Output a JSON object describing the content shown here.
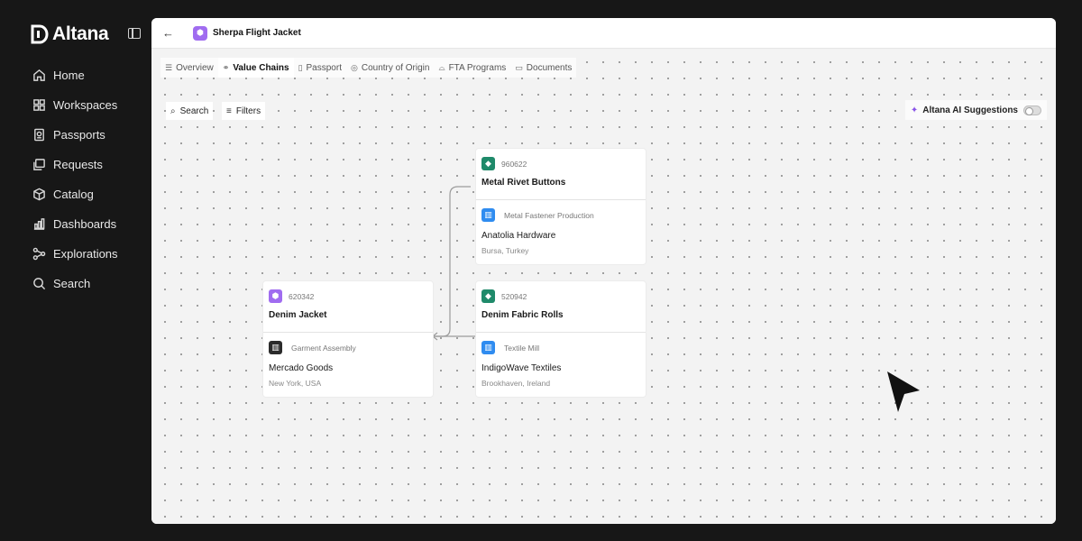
{
  "app": {
    "brand": "Altana"
  },
  "sidebar": {
    "items": [
      {
        "label": "Home",
        "icon": "home-icon"
      },
      {
        "label": "Workspaces",
        "icon": "grid-icon"
      },
      {
        "label": "Passports",
        "icon": "passport-icon"
      },
      {
        "label": "Requests",
        "icon": "requests-icon"
      },
      {
        "label": "Catalog",
        "icon": "box-icon"
      },
      {
        "label": "Dashboards",
        "icon": "bar-chart-icon"
      },
      {
        "label": "Explorations",
        "icon": "network-icon"
      },
      {
        "label": "Search",
        "icon": "search-icon"
      }
    ]
  },
  "header": {
    "back_icon": "arrow-left-icon",
    "product_title": "Sherpa Flight Jacket"
  },
  "tabs": [
    {
      "label": "Overview",
      "icon": "list-icon",
      "active": false
    },
    {
      "label": "Value Chains",
      "icon": "chain-icon",
      "active": true
    },
    {
      "label": "Passport",
      "icon": "document-icon",
      "active": false
    },
    {
      "label": "Country of Origin",
      "icon": "globe-icon",
      "active": false
    },
    {
      "label": "FTA Programs",
      "icon": "handshake-icon",
      "active": false
    },
    {
      "label": "Documents",
      "icon": "folder-icon",
      "active": false
    }
  ],
  "toolbar": {
    "search_label": "Search",
    "filters_label": "Filters"
  },
  "ai": {
    "label": "Altana AI Suggestions",
    "enabled": false
  },
  "cards": {
    "rivet": {
      "code": "960622",
      "name": "Metal Rivet Buttons",
      "stage": "Metal Fastener Production",
      "supplier": "Anatolia Hardware",
      "location": "Bursa, Turkey"
    },
    "fabric": {
      "code": "520942",
      "name": "Denim Fabric Rolls",
      "stage": "Textile Mill",
      "supplier": "IndigoWave Textiles",
      "location": "Brookhaven, Ireland"
    },
    "jacket": {
      "code": "620342",
      "name": "Denim Jacket",
      "stage": "Garment Assembly",
      "supplier": "Mercado Goods",
      "location": "New York, USA"
    }
  },
  "colors": {
    "background": "#171717",
    "accent_purple": "#a06cf0",
    "accent_green": "#1f8a6a",
    "accent_blue": "#2f8cf0"
  }
}
